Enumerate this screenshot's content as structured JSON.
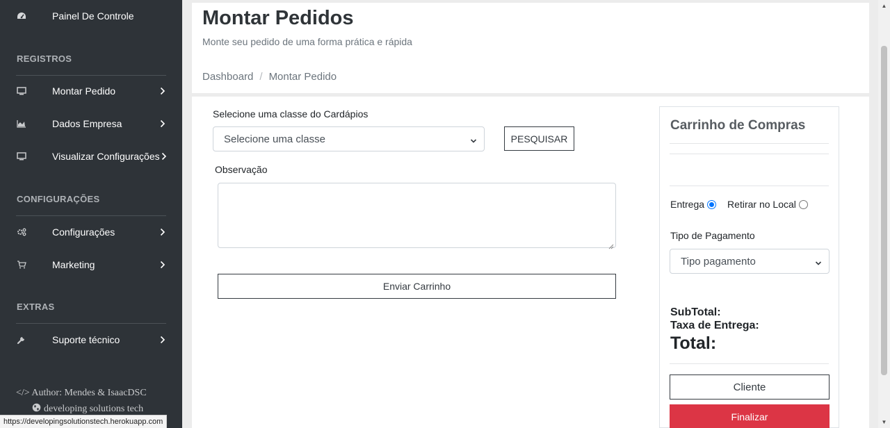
{
  "sidebar": {
    "dashboard_label": "Painel De Controle",
    "sections": {
      "registros": "REGISTROS",
      "configuracoes": "CONFIGURAÇÕES",
      "extras": "EXTRAS"
    },
    "items": [
      {
        "label": "Montar Pedido",
        "icon": "monitor-icon"
      },
      {
        "label": "Dados Empresa",
        "icon": "area-chart-icon"
      },
      {
        "label": "Visualizar Configurações",
        "icon": "monitor-icon"
      },
      {
        "label": "Configurações",
        "icon": "gears-icon"
      },
      {
        "label": "Marketing",
        "icon": "cart-icon"
      },
      {
        "label": "Suporte técnico",
        "icon": "wrench-icon"
      }
    ],
    "footer": {
      "author": "</> Author: Mendes & IsaacDSC",
      "company": "developing solutions tech"
    }
  },
  "status_bar_url": "https://developingsolutionstech.herokuapp.com",
  "header": {
    "title": "Montar Pedidos",
    "subtitle": "Monte seu pedido de uma forma prática e rápida",
    "breadcrumb": [
      "Dashboard",
      "Montar Pedido"
    ],
    "separator": "/"
  },
  "order_form": {
    "class_label": "Selecione uma classe do Cardápios",
    "class_select_value": "Selecione uma classe",
    "search_button": "PESQUISAR",
    "note_label": "Observação",
    "note_value": "",
    "send_cart_button": "Enviar Carrinho"
  },
  "cart": {
    "title": "Carrinho de Compras",
    "delivery_option": "Entrega",
    "pickup_option": "Retirar no Local",
    "selected_option": "Entrega",
    "payment_label": "Tipo de Pagamento",
    "payment_select_value": "Tipo pagamento",
    "subtotal_label": "SubTotal:",
    "delivery_fee_label": "Taxa de Entrega:",
    "total_label": "Total:",
    "client_button": "Cliente",
    "finalize_button": "Finalizar"
  },
  "colors": {
    "sidebar_bg": "#2e3338",
    "finalize_red": "#dc3545",
    "radio_blue": "#0075ff"
  }
}
